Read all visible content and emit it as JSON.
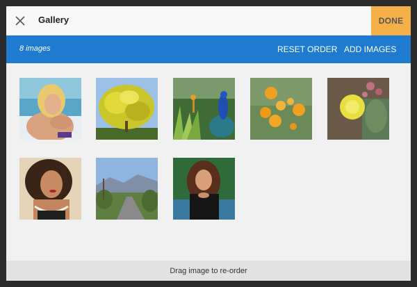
{
  "header": {
    "title": "Gallery",
    "done_label": "DONE"
  },
  "toolbar": {
    "count_label": "8 images",
    "reset_label": "RESET ORDER",
    "add_label": "ADD IMAGES"
  },
  "gallery": {
    "images": [
      {
        "subject": "woman-blonde-poolside"
      },
      {
        "subject": "yellow-flowering-tree"
      },
      {
        "subject": "peacock-in-garden"
      },
      {
        "subject": "orange-poppies"
      },
      {
        "subject": "cactus-yellow-flower"
      },
      {
        "subject": "woman-curly-hair-pearls"
      },
      {
        "subject": "road-with-mountains"
      },
      {
        "subject": "woman-brunette-black-top"
      }
    ]
  },
  "footer": {
    "hint": "Drag image to re-order"
  },
  "colors": {
    "accent": "#1e7bd0",
    "done": "#f6b04a"
  }
}
